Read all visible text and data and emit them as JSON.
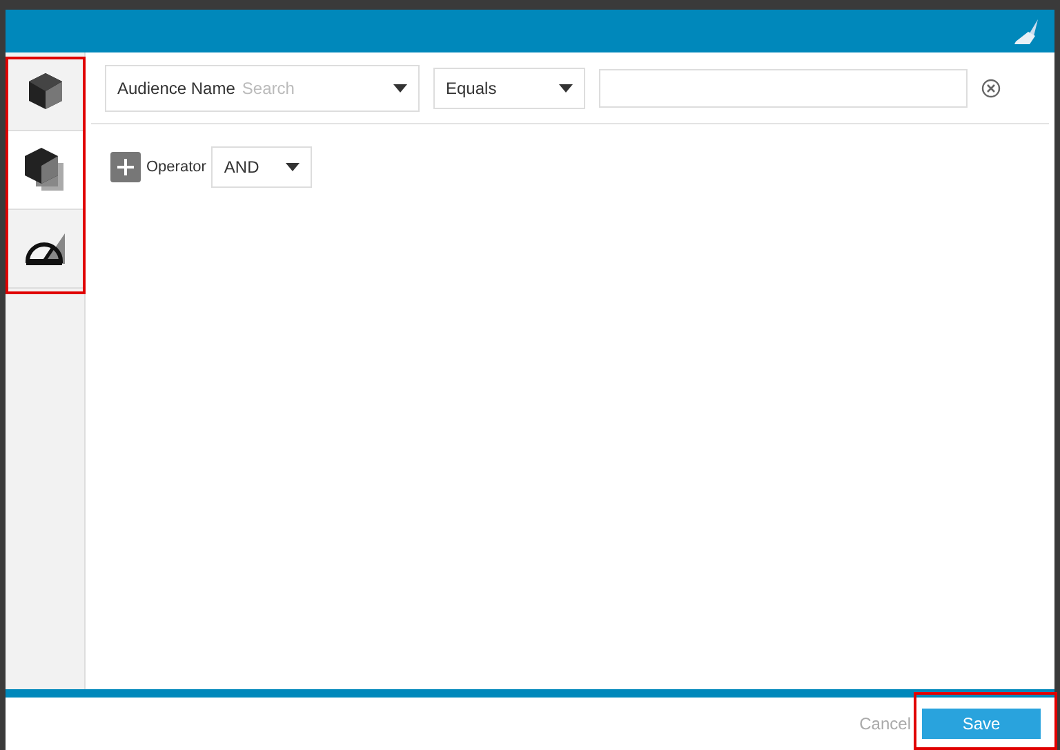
{
  "sidebar": {
    "items": [
      {
        "kind": "cube",
        "selected": false
      },
      {
        "kind": "cubes",
        "selected": true
      },
      {
        "kind": "protractor",
        "selected": false
      }
    ]
  },
  "filter": {
    "field_label": "Audience Name",
    "field_placeholder": "Search",
    "operator_value": "Equals"
  },
  "operator": {
    "label": "Operator",
    "value": "AND"
  },
  "footer": {
    "cancel": "Cancel",
    "save": "Save"
  }
}
